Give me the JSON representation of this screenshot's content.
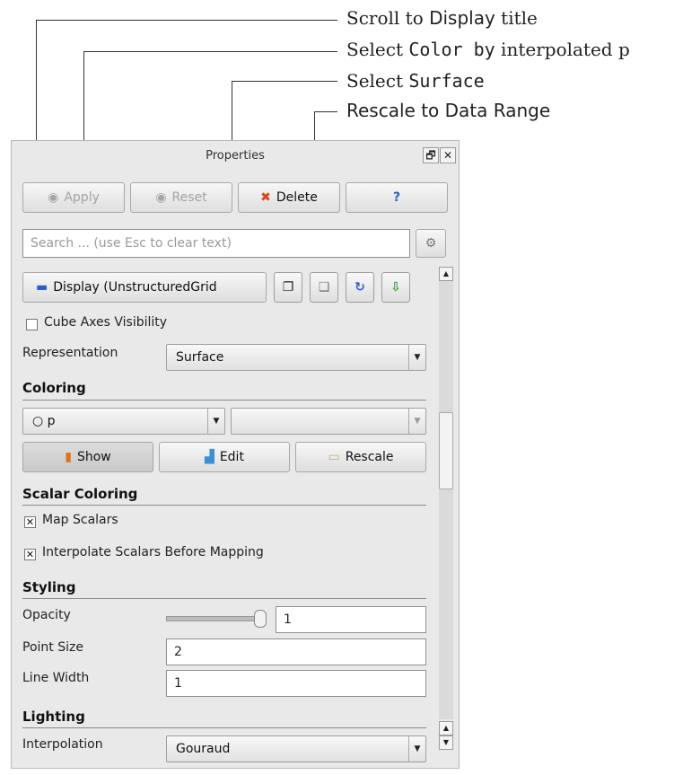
{
  "annotations": [
    {
      "pre": "Scroll to ",
      "mono": "",
      "sans": "Display",
      "post": " title"
    },
    {
      "pre": "Select ",
      "mono": "Color by",
      "sans": "",
      "post": " interpolated p"
    },
    {
      "pre": "Select ",
      "mono": "Surface",
      "sans": "",
      "post": ""
    },
    {
      "pre": "",
      "mono": "",
      "sans": "Rescale to Data Range",
      "post": ""
    }
  ],
  "panel": {
    "title": "Properties",
    "window_buttons": {
      "float": "🗗",
      "close": "✕"
    },
    "buttons": {
      "apply": {
        "label": "Apply",
        "icon": "apply-icon",
        "enabled": false
      },
      "reset": {
        "label": "Reset",
        "icon": "reset-icon",
        "enabled": false
      },
      "delete": {
        "label": "Delete",
        "icon": "delete-x-icon",
        "enabled": true
      },
      "help": {
        "label": "?",
        "icon": "help-icon",
        "enabled": true
      }
    },
    "search": {
      "placeholder": "Search ... (use Esc to clear text)",
      "value": ""
    },
    "display": {
      "label": "Display (UnstructuredGrid",
      "icon": "display-dash-icon"
    },
    "cube_axes": {
      "label": "Cube Axes Visibility",
      "checked": false
    },
    "representation": {
      "label": "Representation",
      "value": "Surface"
    },
    "coloring": {
      "title": "Coloring",
      "color_by": "○ p",
      "component": "",
      "show_label": "Show",
      "edit_label": "Edit",
      "rescale_label": "Rescale"
    },
    "scalar_coloring": {
      "title": "Scalar Coloring",
      "map_scalars": {
        "label": "Map Scalars",
        "checked": true
      },
      "interpolate": {
        "label": "Interpolate Scalars Before Mapping",
        "checked": true
      }
    },
    "styling": {
      "title": "Styling",
      "opacity": {
        "label": "Opacity",
        "value": "1",
        "slider_fraction": 1.0
      },
      "point_size": {
        "label": "Point Size",
        "value": "2"
      },
      "line_width": {
        "label": "Line Width",
        "value": "1"
      }
    },
    "lighting": {
      "title": "Lighting",
      "interpolation": {
        "label": "Interpolation",
        "value": "Gouraud"
      }
    }
  },
  "colors": {
    "accent_blue": "#2a5fc9",
    "delete_red": "#d84a1c"
  }
}
